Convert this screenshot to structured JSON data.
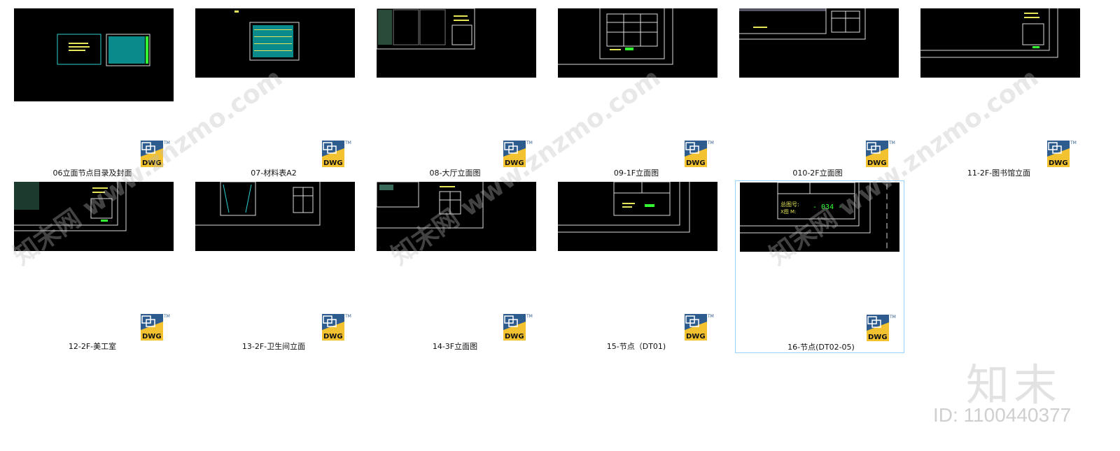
{
  "files": [
    {
      "name": "06立面节点目录及封面",
      "ext": "DWG",
      "thumb_variant": "cover"
    },
    {
      "name": "07-材料表A2",
      "ext": "DWG",
      "thumb_variant": "table"
    },
    {
      "name": "08-大厅立面图",
      "ext": "DWG",
      "thumb_variant": "elev"
    },
    {
      "name": "09-1F立面图",
      "ext": "DWG",
      "thumb_variant": "frame"
    },
    {
      "name": "010-2F立面图",
      "ext": "DWG",
      "thumb_variant": "elev"
    },
    {
      "name": "11-2F-图书馆立面",
      "ext": "DWG",
      "thumb_variant": "frame"
    },
    {
      "name": "12-2F-美工室",
      "ext": "DWG",
      "thumb_variant": "frame"
    },
    {
      "name": "13-2F-卫生间立面",
      "ext": "DWG",
      "thumb_variant": "frame"
    },
    {
      "name": "14-3F立面图",
      "ext": "DWG",
      "thumb_variant": "elev"
    },
    {
      "name": "15-节点（DT01)",
      "ext": "DWG",
      "thumb_variant": "frame"
    },
    {
      "name": "16-节点(DT02-05)",
      "ext": "DWG",
      "thumb_variant": "detail",
      "selected": true
    }
  ],
  "thumb_text": {
    "index_label": "总图号:",
    "index_sub": "X图 M:",
    "index_number": "- 034 -"
  },
  "watermark": {
    "logo": "知末",
    "id_text": "ID: 1100440377",
    "diagonal_text": "知末网 www.znzmo.com"
  },
  "colors": {
    "thumb_bg": "#000000",
    "cad_yellow": "#e6e65a",
    "cad_green": "#33ff33",
    "cad_cyan": "#2fd0d0",
    "selection_border": "#99d1ff",
    "dwg_blue": "#2f5c8f",
    "dwg_yellow": "#f2c230"
  }
}
